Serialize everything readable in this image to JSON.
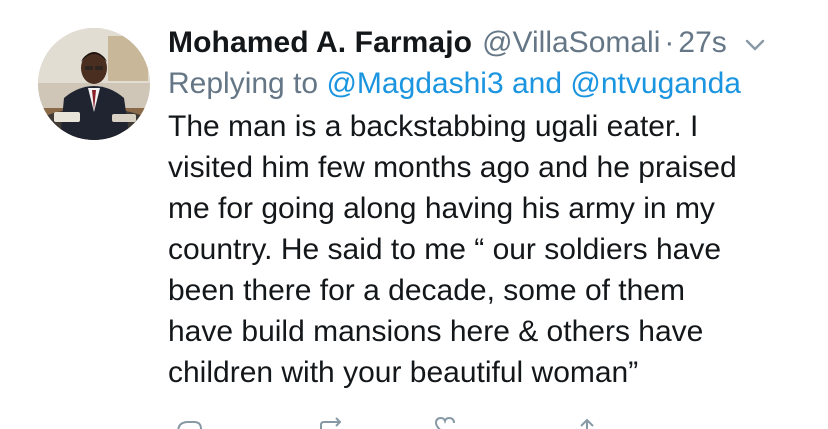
{
  "tweet": {
    "author_name": "Mohamed A. Farmajo",
    "handle": "@VillaSomali",
    "separator": "·",
    "time": "27s",
    "replying_prefix": "Replying to",
    "replying_mention_1": "@Magdashi3",
    "replying_and": "and",
    "replying_mention_2": "@ntvuganda",
    "body_lines": [
      "The man is a backstabbing ugali eater. I",
      "visited him few months ago and he praised",
      "me for going along having his army in my",
      "country. He said to me “ our soldiers have",
      "been there for a decade, some of them",
      "have build mansions here & others have",
      "children with your beautiful woman”"
    ]
  },
  "icons": {
    "menu": "chevron-down-icon",
    "actions": [
      "reply-icon",
      "retweet-icon",
      "like-icon",
      "share-icon"
    ]
  },
  "colors": {
    "text": "#14171a",
    "secondary": "#657786",
    "link": "#1b95e0"
  }
}
